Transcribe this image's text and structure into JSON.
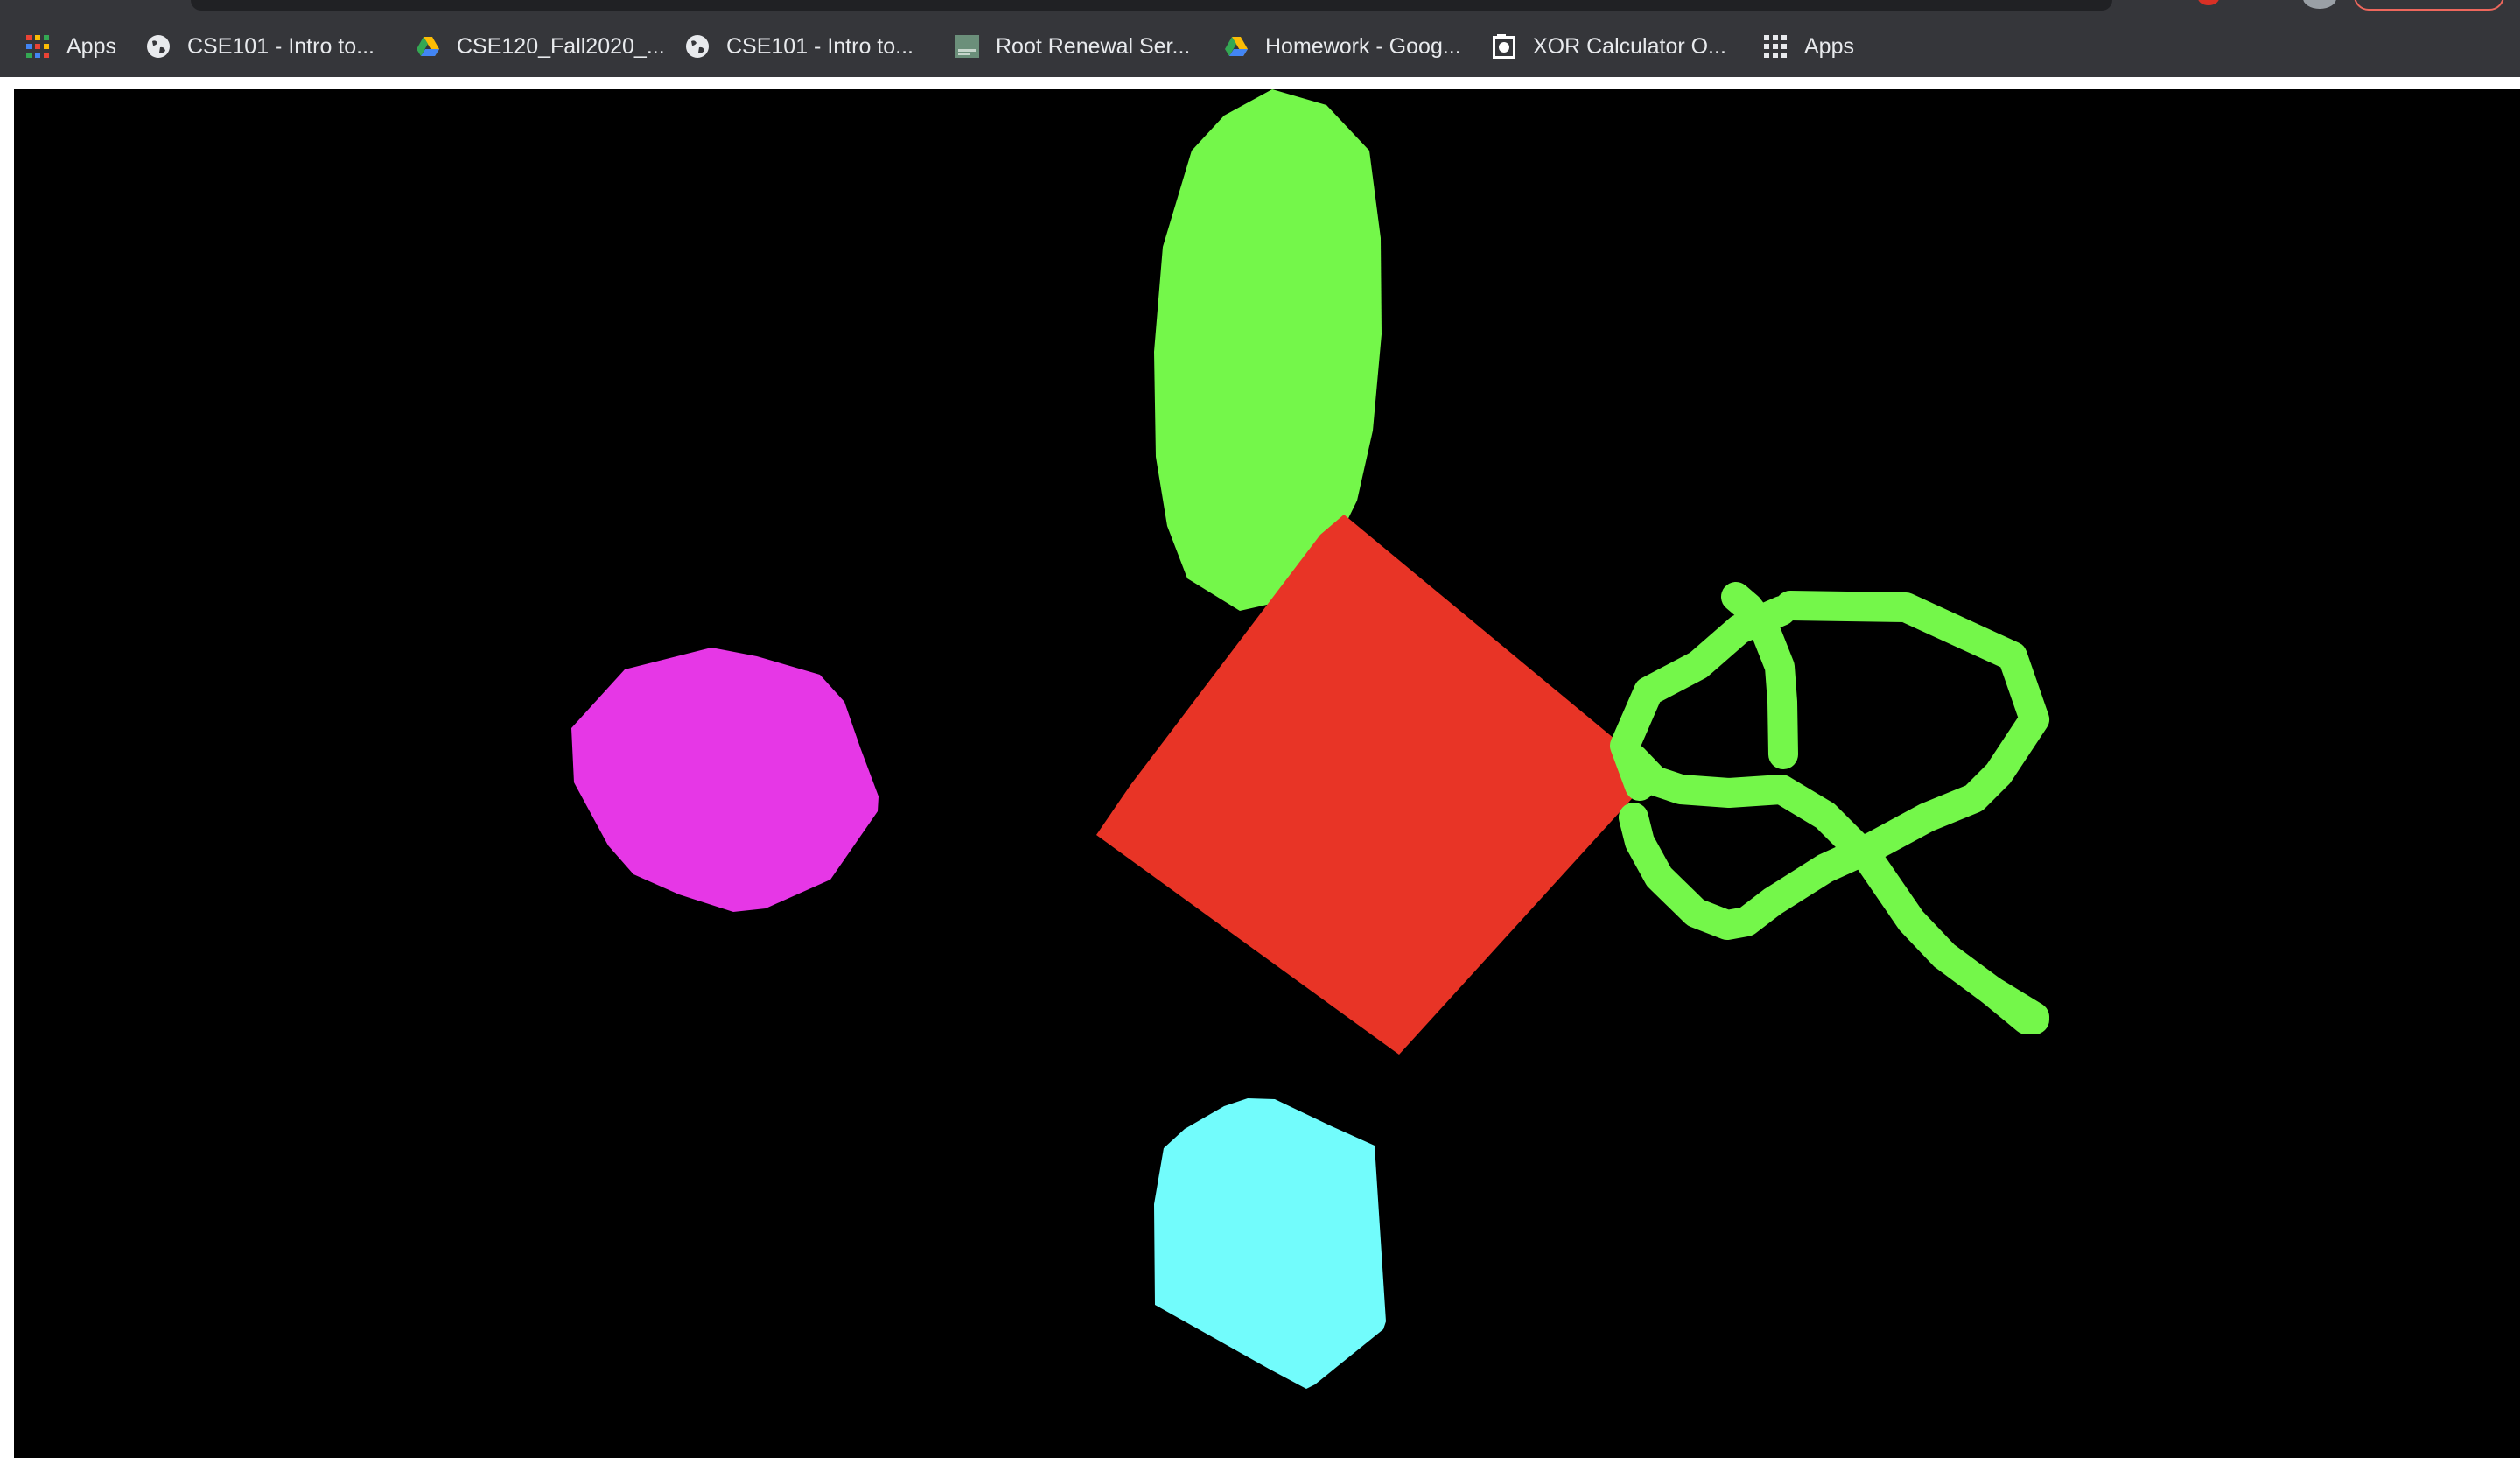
{
  "bookmarks": [
    {
      "label": "Apps",
      "icon": "apps-grid-icon"
    },
    {
      "label": "CSE101 - Intro to...",
      "icon": "globe-icon"
    },
    {
      "label": "CSE120_Fall2020_...",
      "icon": "google-drive-icon"
    },
    {
      "label": "CSE101 - Intro to...",
      "icon": "globe-icon"
    },
    {
      "label": "Root Renewal Ser...",
      "icon": "site-favicon-icon"
    },
    {
      "label": "Homework - Goog...",
      "icon": "google-drive-icon"
    },
    {
      "label": "XOR Calculator O...",
      "icon": "calculator-icon"
    },
    {
      "label": "Apps",
      "icon": "apps-grid-icon"
    }
  ],
  "canvas": {
    "background": "#000000",
    "shapes": [
      {
        "name": "green-ellipse-shape",
        "color": "#74f74a"
      },
      {
        "name": "red-diamond-shape",
        "color": "#e83426"
      },
      {
        "name": "magenta-blob-shape",
        "color": "#e637e6"
      },
      {
        "name": "cyan-hexagon-shape",
        "color": "#72fcfc"
      },
      {
        "name": "green-scribble-shape",
        "color": "#74f74a"
      }
    ]
  }
}
